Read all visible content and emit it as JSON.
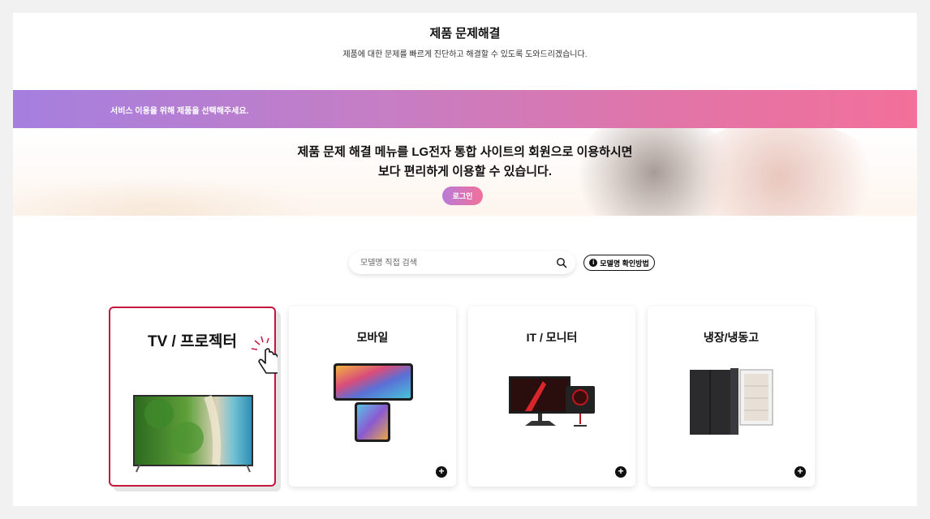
{
  "header": {
    "title": "제품 문제해결",
    "description": "제품에 대한 문제를 빠르게 진단하고 해결할 수 있도록 도와드리겠습니다."
  },
  "service_bar": {
    "text": "서비스 이용을 위해 제품을 선택해주세요."
  },
  "login_banner": {
    "line1": "제품 문제 해결 메뉴를 LG전자 통합 사이트의 회원으로 이용하시면",
    "line2": "보다 편리하게 이용할 수 있습니다.",
    "login_label": "로그인"
  },
  "search": {
    "placeholder": "모델명 직접 검색",
    "icon": "search-icon"
  },
  "model_help": {
    "label": "모델명 확인방법",
    "icon": "info-icon"
  },
  "categories": [
    {
      "label": "TV / 프로젝터",
      "selected": true
    },
    {
      "label": "모바일",
      "selected": false
    },
    {
      "label": "IT / 모니터",
      "selected": false
    },
    {
      "label": "냉장/냉동고",
      "selected": false
    }
  ],
  "colors": {
    "accent": "#c4173d",
    "gradient_start": "#a57fdf",
    "gradient_end": "#f2709a"
  }
}
